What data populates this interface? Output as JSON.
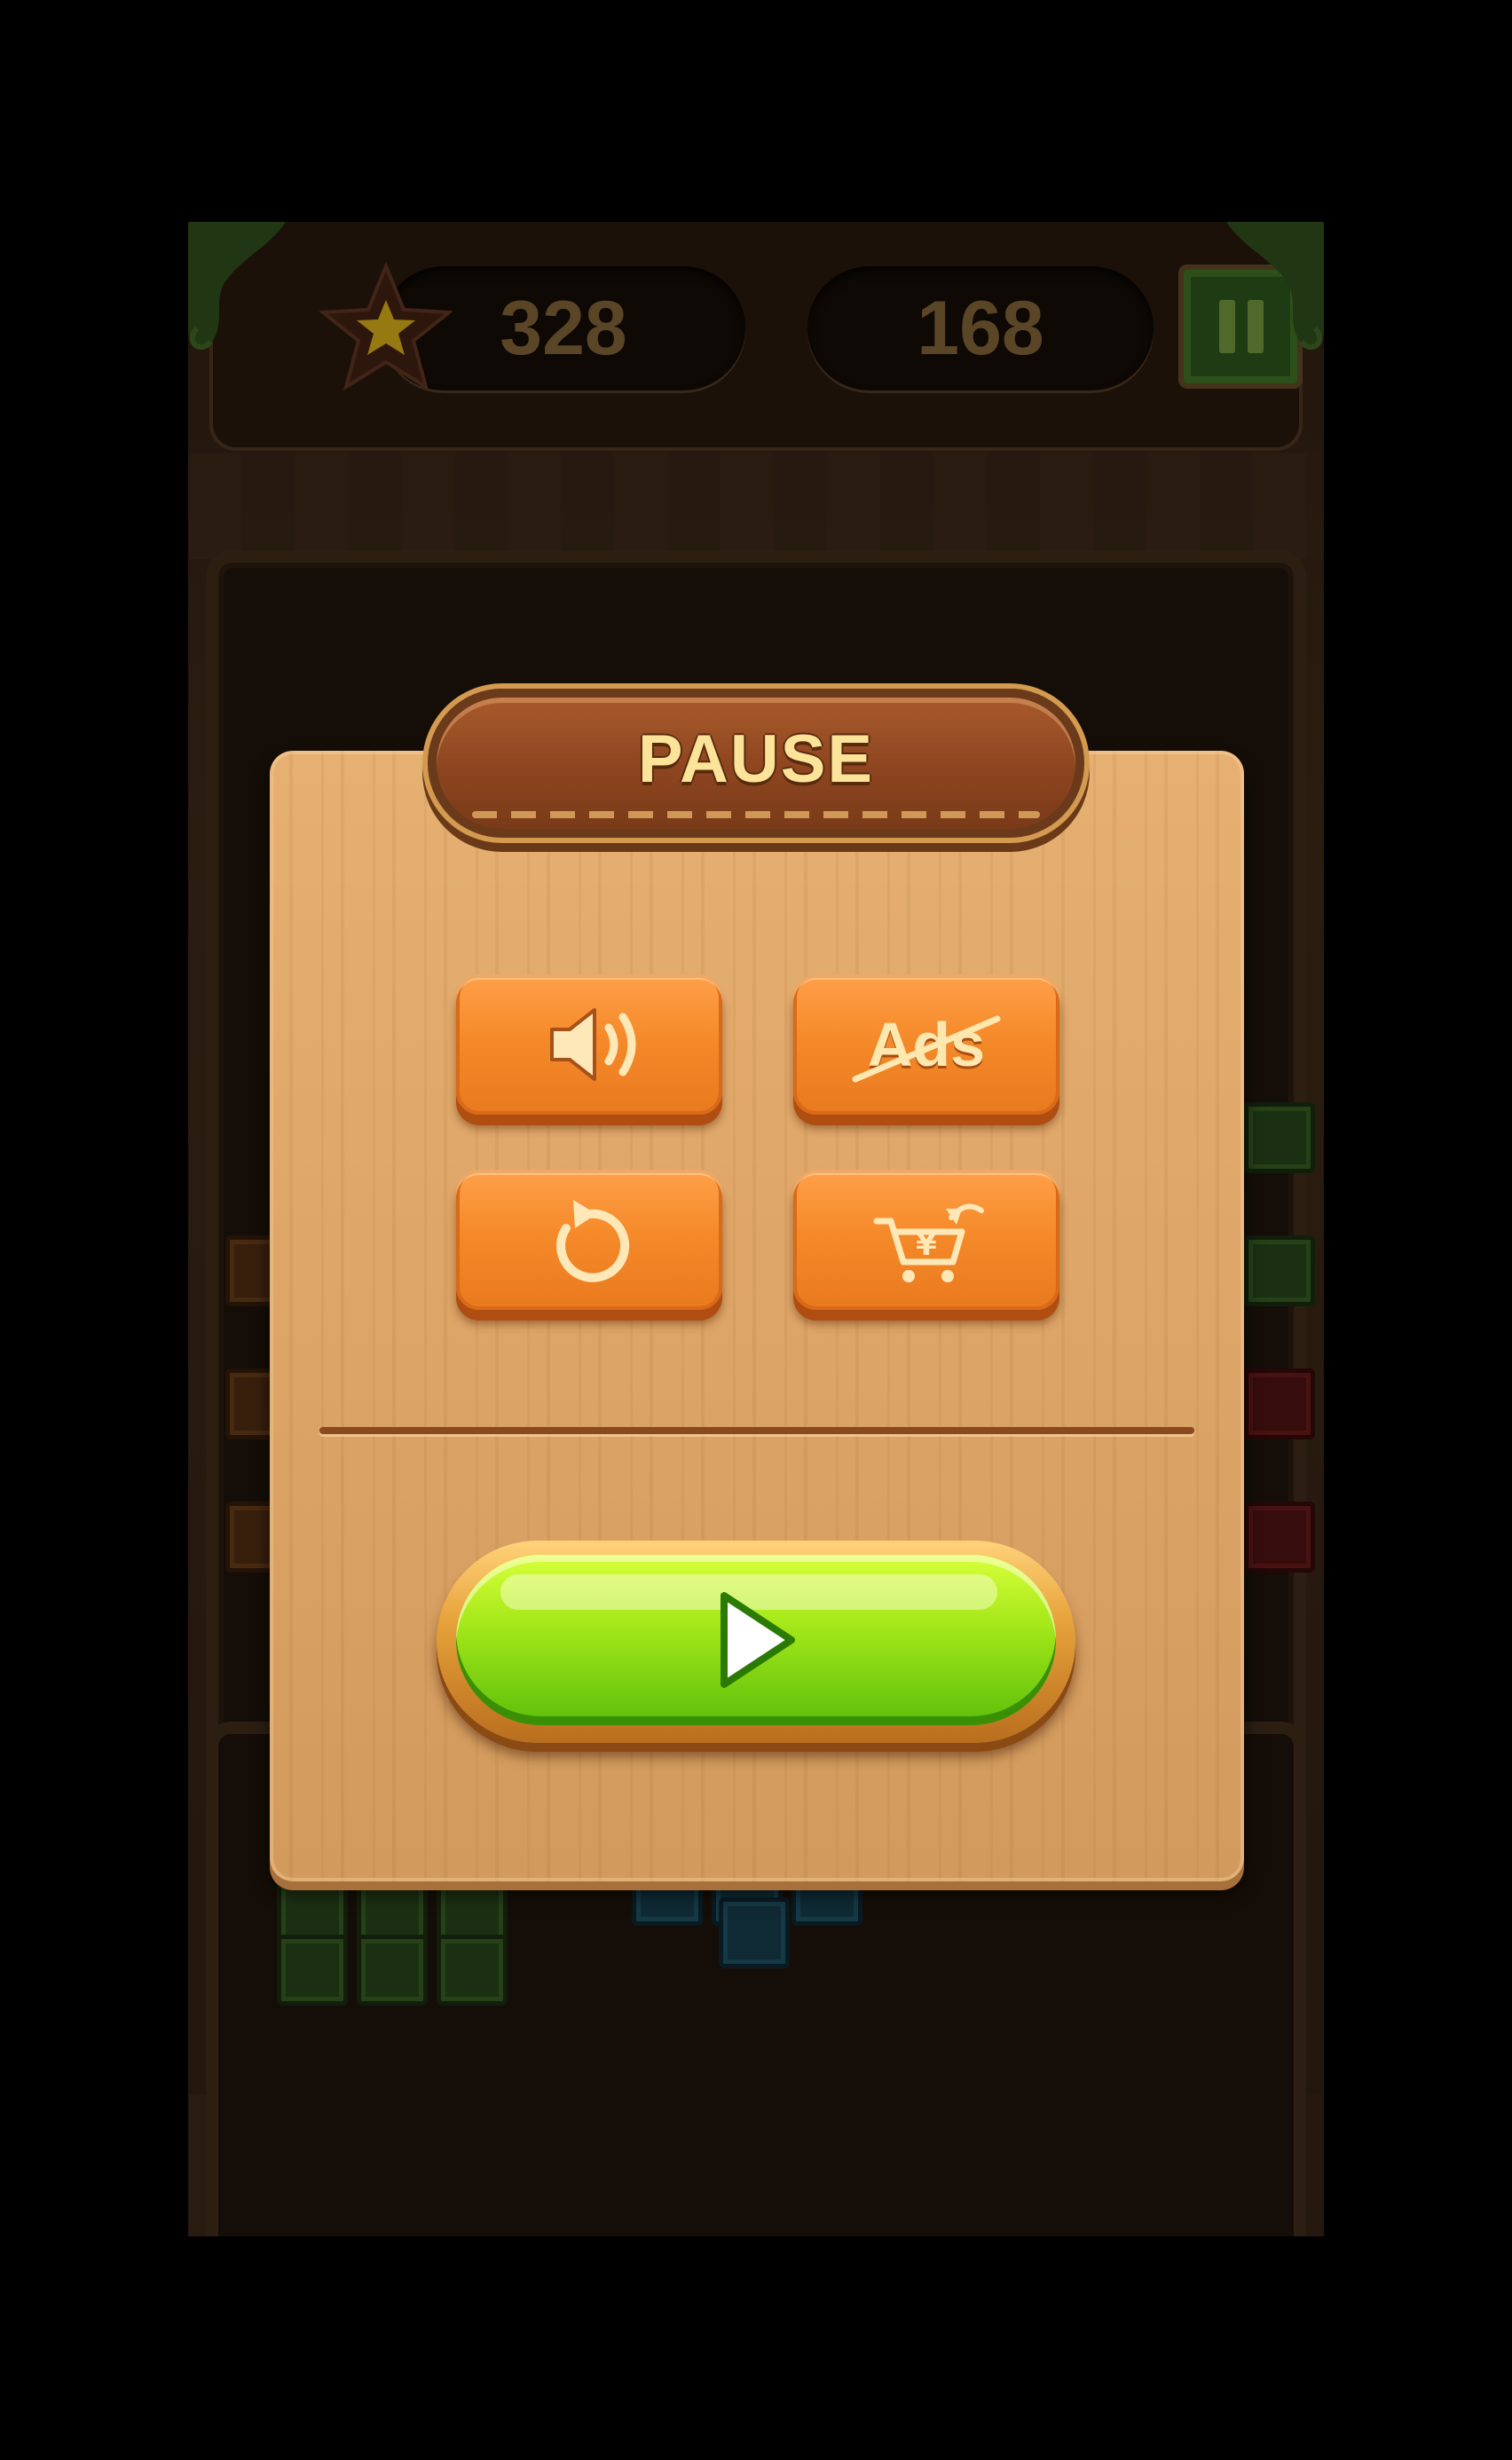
{
  "hud": {
    "score": "328",
    "best_score": "168"
  },
  "pause_dialog": {
    "title": "PAUSE",
    "no_ads_label": "Ads"
  },
  "icons": {
    "star": "star-icon",
    "pause": "pause-icon",
    "sound": "speaker-icon",
    "no_ads": "no-ads-icon",
    "restart": "restart-icon",
    "shop": "shopping-cart-icon",
    "resume": "play-icon"
  },
  "colors": {
    "dialog_wood": "#dda567",
    "title_plaque": "#8d4520",
    "option_button": "#f58a2a",
    "resume_button": "#a6e81a",
    "title_text": "#fbe49a",
    "hud_digits": "#7a5c34"
  }
}
